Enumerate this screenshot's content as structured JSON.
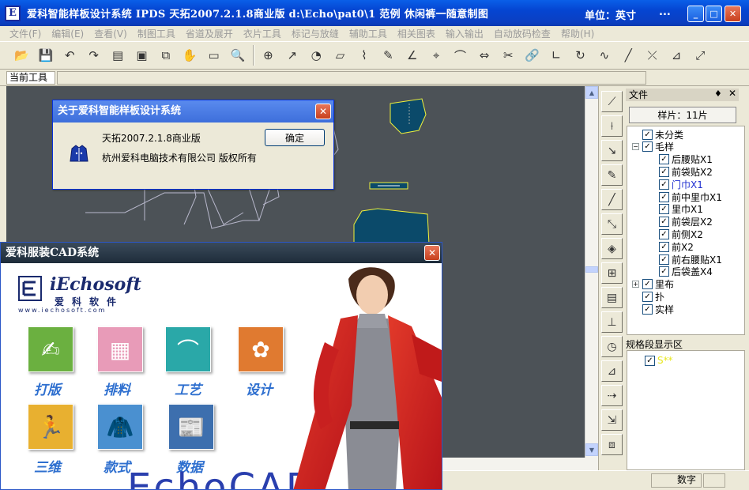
{
  "window": {
    "title": "爱科智能样板设计系统  IPDS  天拓2007.2.1.8商业版   d:\\Echo\\pat0\\1   范例   休闲裤一随意制图",
    "unit": "单位：英寸",
    "dots": "...",
    "minimize": "_",
    "maximize": "□",
    "close": "✕",
    "app_icon_letter": "E"
  },
  "menu": [
    "文件(F)",
    "编辑(E)",
    "查看(V)",
    "制图工具",
    "省道及展开",
    "衣片工具",
    "标记与放缝",
    "辅助工具",
    "相关图表",
    "输入输出",
    "自动放码检查",
    "帮助(H)"
  ],
  "toolbar_icons": [
    "open-folder-icon",
    "save-icon",
    "undo-icon",
    "redo-icon",
    "list-icon",
    "stitch-icon",
    "layer-icon",
    "select-icon",
    "display-icon",
    "zoom-icon",
    "target-icon",
    "measure-icon",
    "tape-icon",
    "ruler-icon",
    "scissor-curve-icon",
    "pen-icon",
    "angle-icon",
    "node-icon",
    "curve-icon",
    "mirror-icon",
    "cut-icon",
    "link-icon",
    "corner-icon",
    "rotate-icon",
    "smooth-icon",
    "line-icon",
    "split-icon",
    "fold-icon",
    "expand-icon"
  ],
  "current_tool_label": "当前工具",
  "about_dialog": {
    "title": "关于爱科智能样板设计系统",
    "version": "天拓2007.2.1.8商业版",
    "copyright": "杭州爱科电脑技术有限公司 版权所有",
    "ok_label": "确定",
    "close": "✕"
  },
  "file_panel": {
    "title": "文件",
    "pin": "♦",
    "close": "✕",
    "pieces_button": "样片：11片",
    "tree": [
      {
        "label": "未分类",
        "level": 0,
        "checked": true,
        "expander": ""
      },
      {
        "label": "毛样",
        "level": 0,
        "checked": true,
        "expander": "−"
      },
      {
        "label": "后腰贴X1",
        "level": 1,
        "checked": true
      },
      {
        "label": "前袋贴X2",
        "level": 1,
        "checked": true
      },
      {
        "label": "门巾X1",
        "level": 1,
        "checked": true,
        "highlight": true
      },
      {
        "label": "前中里巾X1",
        "level": 1,
        "checked": true
      },
      {
        "label": "里巾X1",
        "level": 1,
        "checked": true
      },
      {
        "label": "前袋层X2",
        "level": 1,
        "checked": true
      },
      {
        "label": "前侧X2",
        "level": 1,
        "checked": true
      },
      {
        "label": "前X2",
        "level": 1,
        "checked": true
      },
      {
        "label": "前右腰贴X1",
        "level": 1,
        "checked": true
      },
      {
        "label": "后袋盖X4",
        "level": 1,
        "checked": true
      },
      {
        "label": "里布",
        "level": 0,
        "checked": true,
        "expander": "+"
      },
      {
        "label": "扑",
        "level": 0,
        "checked": true,
        "expander": ""
      },
      {
        "label": "实样",
        "level": 0,
        "checked": true,
        "expander": ""
      }
    ]
  },
  "spec_panel": {
    "title": "规格段显示区",
    "items": [
      "S**"
    ]
  },
  "status_bar": {
    "mode": "数字"
  },
  "splash": {
    "title": "爱科服装CAD系统",
    "close": "✕",
    "brand_name": "iEchosoft",
    "brand_cn": "爱科软件",
    "brand_url": "www.iechosoft.com",
    "modules": [
      {
        "label": "打版",
        "icon": "pattern-making-icon",
        "color": "#6BB040"
      },
      {
        "label": "排料",
        "icon": "marker-layout-icon",
        "color": "#E89BB8"
      },
      {
        "label": "工艺",
        "icon": "hanger-icon",
        "color": "#2AA8A8"
      },
      {
        "label": "设计",
        "icon": "design-icon",
        "color": "#E07A30"
      },
      {
        "label": "三维",
        "icon": "3d-figure-icon",
        "color": "#E8B030"
      },
      {
        "label": "款式",
        "icon": "jacket-icon",
        "color": "#4A90D0"
      },
      {
        "label": "数据",
        "icon": "data-icon",
        "color": "#3D6FAE"
      }
    ],
    "logo_text": "EchoCAD"
  },
  "colors": {
    "canvas": "#4C5257",
    "piece_fill": "#0B4A6A",
    "piece_outline": "#F2F23A",
    "wire": "#C8C8D8",
    "highlight_text": "#2030D0"
  }
}
